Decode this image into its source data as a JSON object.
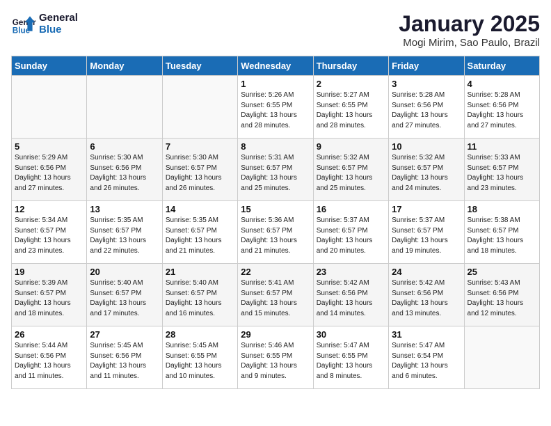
{
  "header": {
    "logo_line1": "General",
    "logo_line2": "Blue",
    "title": "January 2025",
    "subtitle": "Mogi Mirim, Sao Paulo, Brazil"
  },
  "days_of_week": [
    "Sunday",
    "Monday",
    "Tuesday",
    "Wednesday",
    "Thursday",
    "Friday",
    "Saturday"
  ],
  "weeks": [
    [
      {
        "num": "",
        "info": ""
      },
      {
        "num": "",
        "info": ""
      },
      {
        "num": "",
        "info": ""
      },
      {
        "num": "1",
        "info": "Sunrise: 5:26 AM\nSunset: 6:55 PM\nDaylight: 13 hours\nand 28 minutes."
      },
      {
        "num": "2",
        "info": "Sunrise: 5:27 AM\nSunset: 6:55 PM\nDaylight: 13 hours\nand 28 minutes."
      },
      {
        "num": "3",
        "info": "Sunrise: 5:28 AM\nSunset: 6:56 PM\nDaylight: 13 hours\nand 27 minutes."
      },
      {
        "num": "4",
        "info": "Sunrise: 5:28 AM\nSunset: 6:56 PM\nDaylight: 13 hours\nand 27 minutes."
      }
    ],
    [
      {
        "num": "5",
        "info": "Sunrise: 5:29 AM\nSunset: 6:56 PM\nDaylight: 13 hours\nand 27 minutes."
      },
      {
        "num": "6",
        "info": "Sunrise: 5:30 AM\nSunset: 6:56 PM\nDaylight: 13 hours\nand 26 minutes."
      },
      {
        "num": "7",
        "info": "Sunrise: 5:30 AM\nSunset: 6:57 PM\nDaylight: 13 hours\nand 26 minutes."
      },
      {
        "num": "8",
        "info": "Sunrise: 5:31 AM\nSunset: 6:57 PM\nDaylight: 13 hours\nand 25 minutes."
      },
      {
        "num": "9",
        "info": "Sunrise: 5:32 AM\nSunset: 6:57 PM\nDaylight: 13 hours\nand 25 minutes."
      },
      {
        "num": "10",
        "info": "Sunrise: 5:32 AM\nSunset: 6:57 PM\nDaylight: 13 hours\nand 24 minutes."
      },
      {
        "num": "11",
        "info": "Sunrise: 5:33 AM\nSunset: 6:57 PM\nDaylight: 13 hours\nand 23 minutes."
      }
    ],
    [
      {
        "num": "12",
        "info": "Sunrise: 5:34 AM\nSunset: 6:57 PM\nDaylight: 13 hours\nand 23 minutes."
      },
      {
        "num": "13",
        "info": "Sunrise: 5:35 AM\nSunset: 6:57 PM\nDaylight: 13 hours\nand 22 minutes."
      },
      {
        "num": "14",
        "info": "Sunrise: 5:35 AM\nSunset: 6:57 PM\nDaylight: 13 hours\nand 21 minutes."
      },
      {
        "num": "15",
        "info": "Sunrise: 5:36 AM\nSunset: 6:57 PM\nDaylight: 13 hours\nand 21 minutes."
      },
      {
        "num": "16",
        "info": "Sunrise: 5:37 AM\nSunset: 6:57 PM\nDaylight: 13 hours\nand 20 minutes."
      },
      {
        "num": "17",
        "info": "Sunrise: 5:37 AM\nSunset: 6:57 PM\nDaylight: 13 hours\nand 19 minutes."
      },
      {
        "num": "18",
        "info": "Sunrise: 5:38 AM\nSunset: 6:57 PM\nDaylight: 13 hours\nand 18 minutes."
      }
    ],
    [
      {
        "num": "19",
        "info": "Sunrise: 5:39 AM\nSunset: 6:57 PM\nDaylight: 13 hours\nand 18 minutes."
      },
      {
        "num": "20",
        "info": "Sunrise: 5:40 AM\nSunset: 6:57 PM\nDaylight: 13 hours\nand 17 minutes."
      },
      {
        "num": "21",
        "info": "Sunrise: 5:40 AM\nSunset: 6:57 PM\nDaylight: 13 hours\nand 16 minutes."
      },
      {
        "num": "22",
        "info": "Sunrise: 5:41 AM\nSunset: 6:57 PM\nDaylight: 13 hours\nand 15 minutes."
      },
      {
        "num": "23",
        "info": "Sunrise: 5:42 AM\nSunset: 6:56 PM\nDaylight: 13 hours\nand 14 minutes."
      },
      {
        "num": "24",
        "info": "Sunrise: 5:42 AM\nSunset: 6:56 PM\nDaylight: 13 hours\nand 13 minutes."
      },
      {
        "num": "25",
        "info": "Sunrise: 5:43 AM\nSunset: 6:56 PM\nDaylight: 13 hours\nand 12 minutes."
      }
    ],
    [
      {
        "num": "26",
        "info": "Sunrise: 5:44 AM\nSunset: 6:56 PM\nDaylight: 13 hours\nand 11 minutes."
      },
      {
        "num": "27",
        "info": "Sunrise: 5:45 AM\nSunset: 6:56 PM\nDaylight: 13 hours\nand 11 minutes."
      },
      {
        "num": "28",
        "info": "Sunrise: 5:45 AM\nSunset: 6:55 PM\nDaylight: 13 hours\nand 10 minutes."
      },
      {
        "num": "29",
        "info": "Sunrise: 5:46 AM\nSunset: 6:55 PM\nDaylight: 13 hours\nand 9 minutes."
      },
      {
        "num": "30",
        "info": "Sunrise: 5:47 AM\nSunset: 6:55 PM\nDaylight: 13 hours\nand 8 minutes."
      },
      {
        "num": "31",
        "info": "Sunrise: 5:47 AM\nSunset: 6:54 PM\nDaylight: 13 hours\nand 6 minutes."
      },
      {
        "num": "",
        "info": ""
      }
    ]
  ]
}
